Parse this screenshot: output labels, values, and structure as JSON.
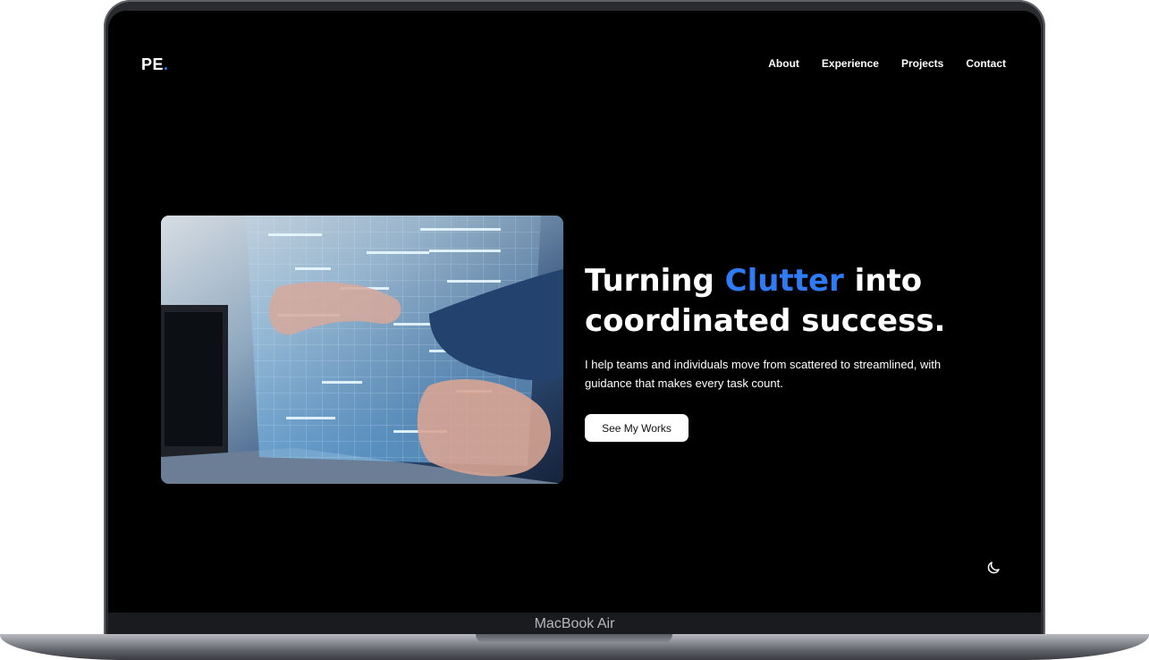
{
  "device": {
    "model_label": "MacBook Air"
  },
  "site": {
    "logo": {
      "text": "PE",
      "dot": "."
    },
    "nav": [
      {
        "label": "About"
      },
      {
        "label": "Experience"
      },
      {
        "label": "Projects"
      },
      {
        "label": "Contact"
      }
    ]
  },
  "hero": {
    "headline_pre": "Turning ",
    "headline_accent": "Clutter",
    "headline_mid": " into",
    "headline_line2": "coordinated success.",
    "subtext": "I help teams and individuals move from scattered to streamlined, with guidance that makes every task count.",
    "cta_label": "See My Works"
  },
  "icons": {
    "theme_toggle": "moon-icon"
  },
  "colors": {
    "accent": "#2f7bf5",
    "background": "#000000",
    "text": "#ffffff",
    "button_bg": "#ffffff",
    "button_text": "#111111"
  }
}
